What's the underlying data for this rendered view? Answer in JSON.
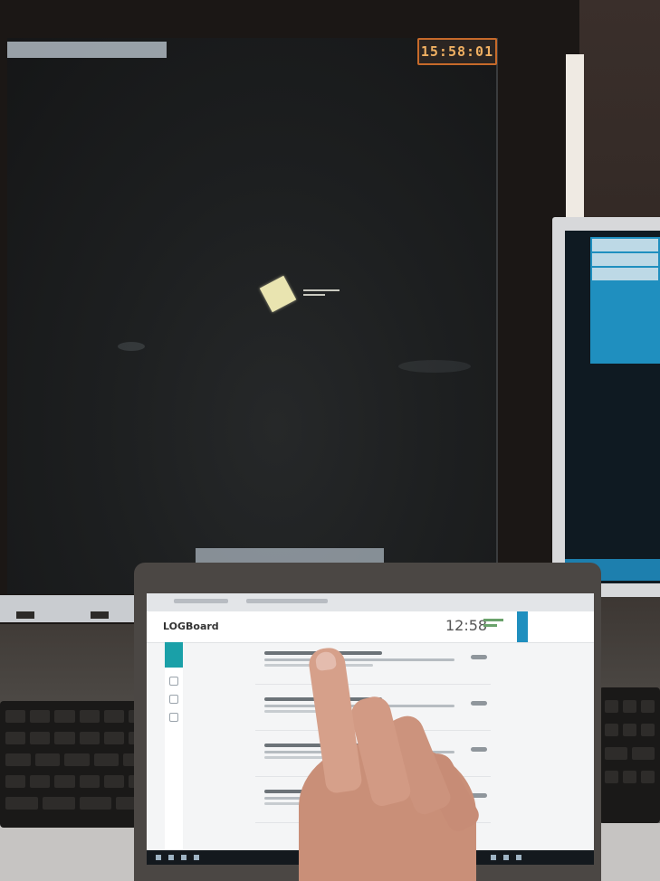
{
  "radar_display": {
    "clock": "15:58:01"
  },
  "tablet_app": {
    "logo": "LOGBoard",
    "time": "12:58"
  },
  "colors": {
    "clock_border": "#c76a2a",
    "clock_text": "#f0b062",
    "aircraft_symbol": "#e9e4b0",
    "app_accent": "#1aa0a8",
    "right_panel": "#1f8fbf"
  }
}
